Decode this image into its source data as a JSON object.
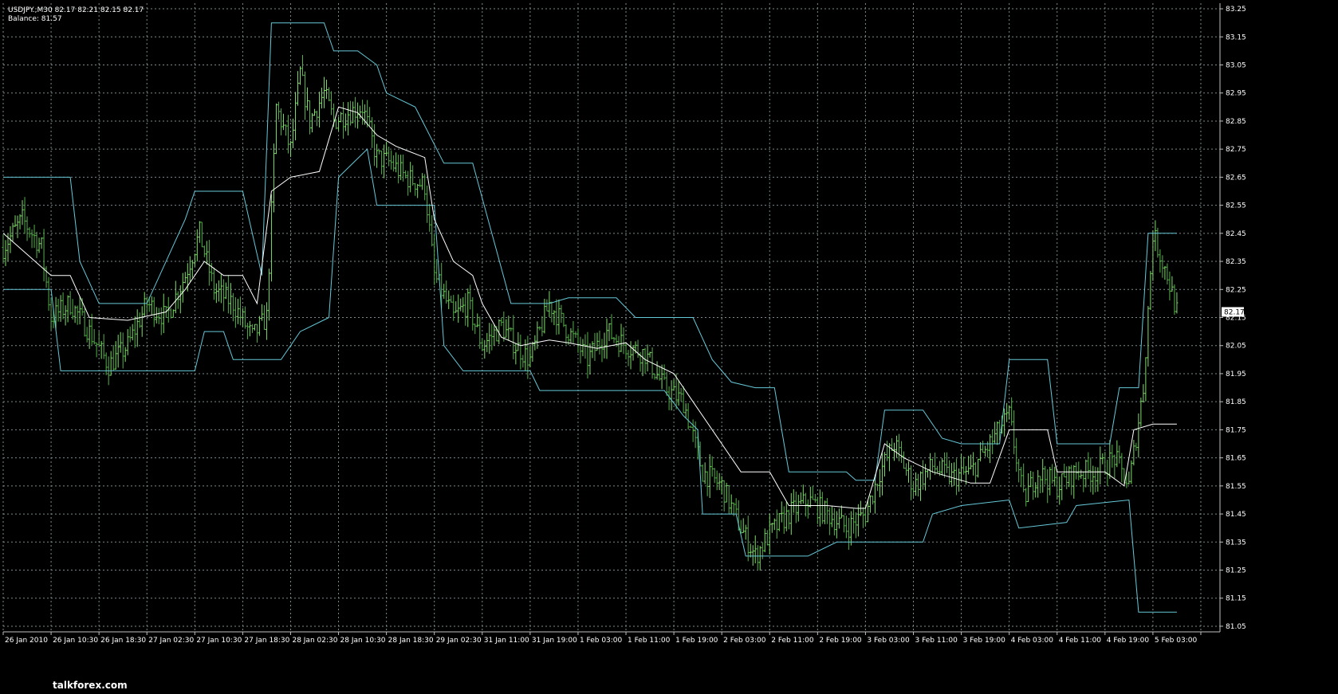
{
  "header": {
    "symbol_line": "USDJPY.,M30  82.17 82.21 82.15 82.17",
    "balance_line": "Balance: 81.57"
  },
  "watermark": {
    "text": "talkforex.com"
  },
  "colors": {
    "background": "#000000",
    "grid": "#7a8a8a",
    "bars": "#55b04a",
    "bars_bright": "#7fdc6a",
    "channel": "#66c8d8",
    "midline": "#ffffff",
    "axis": "#bfbfbf",
    "price_box": "#ffffff"
  },
  "chart_data": {
    "type": "line",
    "title": "",
    "symbol": "USDJPY.",
    "timeframe": "M30",
    "ylim": [
      81.03,
      83.27
    ],
    "yticks": [
      81.05,
      81.15,
      81.25,
      81.35,
      81.45,
      81.55,
      81.65,
      81.75,
      81.85,
      81.95,
      82.05,
      82.15,
      82.25,
      82.35,
      82.45,
      82.55,
      82.65,
      82.75,
      82.85,
      82.95,
      83.05,
      83.15,
      83.25
    ],
    "ytick_labels": [
      "81.05",
      "81.15",
      "81.25",
      "81.35",
      "81.45",
      "81.55",
      "81.65",
      "81.75",
      "81.85",
      "81.95",
      "82.05",
      "82.15",
      "82.25",
      "82.35",
      "82.45",
      "82.55",
      "82.65",
      "82.75",
      "82.85",
      "82.95",
      "83.05",
      "83.15",
      "83.25"
    ],
    "current_price": "82.17",
    "xlim": [
      0,
      254
    ],
    "xticks": [
      0,
      10,
      20,
      30,
      40,
      50,
      60,
      70,
      80,
      90,
      100,
      110,
      120,
      130,
      140,
      150,
      160,
      170,
      180,
      190,
      200,
      210,
      220,
      230,
      240,
      250
    ],
    "xtick_labels": [
      "26 Jan 2010",
      "26 Jan 10:30",
      "26 Jan 18:30",
      "27 Jan 02:30",
      "27 Jan 10:30",
      "27 Jan 18:30",
      "28 Jan 02:30",
      "28 Jan 10:30",
      "28 Jan 18:30",
      "29 Jan 02:30",
      "31 Jan 11:00",
      "31 Jan 19:00",
      "1 Feb 03:00",
      "1 Feb 11:00",
      "1 Feb 19:00",
      "2 Feb 03:00",
      "2 Feb 11:00",
      "2 Feb 19:00",
      "3 Feb 03:00",
      "3 Feb 11:00",
      "3 Feb 19:00",
      "4 Feb 03:00",
      "4 Feb 11:00",
      "4 Feb 19:00",
      "5 Feb 03:00",
      ""
    ],
    "close_anchors": [
      [
        0,
        82.4
      ],
      [
        4,
        82.5
      ],
      [
        8,
        82.4
      ],
      [
        10,
        82.15
      ],
      [
        14,
        82.2
      ],
      [
        18,
        82.1
      ],
      [
        22,
        81.98
      ],
      [
        26,
        82.05
      ],
      [
        30,
        82.2
      ],
      [
        34,
        82.15
      ],
      [
        38,
        82.3
      ],
      [
        41,
        82.45
      ],
      [
        44,
        82.25
      ],
      [
        48,
        82.2
      ],
      [
        52,
        82.08
      ],
      [
        55,
        82.15
      ],
      [
        57,
        82.9
      ],
      [
        60,
        82.75
      ],
      [
        62,
        83.02
      ],
      [
        64,
        82.85
      ],
      [
        67,
        82.95
      ],
      [
        69,
        82.85
      ],
      [
        72,
        82.88
      ],
      [
        75,
        82.9
      ],
      [
        78,
        82.72
      ],
      [
        81,
        82.7
      ],
      [
        84,
        82.65
      ],
      [
        88,
        82.62
      ],
      [
        90,
        82.3
      ],
      [
        94,
        82.15
      ],
      [
        97,
        82.2
      ],
      [
        100,
        82.05
      ],
      [
        104,
        82.12
      ],
      [
        107,
        82.05
      ],
      [
        110,
        82.0
      ],
      [
        114,
        82.2
      ],
      [
        118,
        82.1
      ],
      [
        122,
        82.0
      ],
      [
        126,
        82.1
      ],
      [
        130,
        82.05
      ],
      [
        134,
        82.02
      ],
      [
        138,
        81.9
      ],
      [
        142,
        81.85
      ],
      [
        146,
        81.6
      ],
      [
        150,
        81.55
      ],
      [
        154,
        81.4
      ],
      [
        157,
        81.3
      ],
      [
        160,
        81.38
      ],
      [
        164,
        81.45
      ],
      [
        168,
        81.5
      ],
      [
        172,
        81.45
      ],
      [
        176,
        81.4
      ],
      [
        180,
        81.45
      ],
      [
        183,
        81.6
      ],
      [
        186,
        81.7
      ],
      [
        190,
        81.55
      ],
      [
        194,
        81.62
      ],
      [
        198,
        81.58
      ],
      [
        202,
        81.6
      ],
      [
        206,
        81.7
      ],
      [
        210,
        81.8
      ],
      [
        213,
        81.5
      ],
      [
        216,
        81.6
      ],
      [
        220,
        81.55
      ],
      [
        224,
        81.6
      ],
      [
        228,
        81.6
      ],
      [
        232,
        81.65
      ],
      [
        235,
        81.55
      ],
      [
        238,
        81.9
      ],
      [
        240,
        82.45
      ],
      [
        243,
        82.3
      ],
      [
        245,
        82.17
      ]
    ],
    "series": [
      {
        "role": "upper channel",
        "points": [
          [
            0,
            82.65
          ],
          [
            8,
            82.65
          ],
          [
            14,
            82.65
          ],
          [
            16,
            82.35
          ],
          [
            20,
            82.2
          ],
          [
            30,
            82.2
          ],
          [
            38,
            82.5
          ],
          [
            40,
            82.6
          ],
          [
            50,
            82.6
          ],
          [
            54,
            82.3
          ],
          [
            56,
            83.2
          ],
          [
            67,
            83.2
          ],
          [
            69,
            83.1
          ],
          [
            74,
            83.1
          ],
          [
            78,
            83.05
          ],
          [
            80,
            82.95
          ],
          [
            86,
            82.9
          ],
          [
            92,
            82.7
          ],
          [
            98,
            82.7
          ],
          [
            102,
            82.45
          ],
          [
            106,
            82.2
          ],
          [
            114,
            82.2
          ],
          [
            118,
            82.22
          ],
          [
            128,
            82.22
          ],
          [
            132,
            82.15
          ],
          [
            144,
            82.15
          ],
          [
            148,
            82.0
          ],
          [
            152,
            81.92
          ],
          [
            157,
            81.9
          ],
          [
            161,
            81.9
          ],
          [
            164,
            81.6
          ],
          [
            176,
            81.6
          ],
          [
            178,
            81.57
          ],
          [
            182,
            81.57
          ],
          [
            184,
            81.82
          ],
          [
            192,
            81.82
          ],
          [
            196,
            81.72
          ],
          [
            200,
            81.7
          ],
          [
            208,
            81.7
          ],
          [
            210,
            82.0
          ],
          [
            218,
            82.0
          ],
          [
            220,
            81.7
          ],
          [
            231,
            81.7
          ],
          [
            233,
            81.9
          ],
          [
            237,
            81.9
          ],
          [
            239,
            82.45
          ],
          [
            245,
            82.45
          ]
        ]
      },
      {
        "role": "lower channel",
        "points": [
          [
            0,
            82.25
          ],
          [
            10,
            82.25
          ],
          [
            12,
            81.96
          ],
          [
            30,
            81.96
          ],
          [
            40,
            81.96
          ],
          [
            42,
            82.1
          ],
          [
            46,
            82.1
          ],
          [
            48,
            82.0
          ],
          [
            58,
            82.0
          ],
          [
            62,
            82.1
          ],
          [
            68,
            82.15
          ],
          [
            70,
            82.65
          ],
          [
            76,
            82.75
          ],
          [
            78,
            82.55
          ],
          [
            90,
            82.55
          ],
          [
            92,
            82.05
          ],
          [
            96,
            81.96
          ],
          [
            110,
            81.96
          ],
          [
            112,
            81.89
          ],
          [
            122,
            81.89
          ],
          [
            124,
            81.89
          ],
          [
            138,
            81.89
          ],
          [
            142,
            81.8
          ],
          [
            145,
            81.75
          ],
          [
            146,
            81.45
          ],
          [
            153,
            81.45
          ],
          [
            155,
            81.3
          ],
          [
            168,
            81.3
          ],
          [
            174,
            81.35
          ],
          [
            192,
            81.35
          ],
          [
            194,
            81.45
          ],
          [
            200,
            81.48
          ],
          [
            210,
            81.5
          ],
          [
            212,
            81.4
          ],
          [
            222,
            81.42
          ],
          [
            224,
            81.48
          ],
          [
            235,
            81.5
          ],
          [
            237,
            81.1
          ],
          [
            245,
            81.1
          ]
        ]
      },
      {
        "role": "middle line",
        "points": [
          [
            0,
            82.45
          ],
          [
            10,
            82.3
          ],
          [
            14,
            82.3
          ],
          [
            18,
            82.15
          ],
          [
            26,
            82.14
          ],
          [
            34,
            82.17
          ],
          [
            38,
            82.25
          ],
          [
            42,
            82.35
          ],
          [
            46,
            82.3
          ],
          [
            50,
            82.3
          ],
          [
            53,
            82.2
          ],
          [
            56,
            82.6
          ],
          [
            60,
            82.65
          ],
          [
            66,
            82.67
          ],
          [
            70,
            82.9
          ],
          [
            74,
            82.88
          ],
          [
            78,
            82.8
          ],
          [
            82,
            82.76
          ],
          [
            88,
            82.72
          ],
          [
            90,
            82.5
          ],
          [
            94,
            82.35
          ],
          [
            98,
            82.3
          ],
          [
            100,
            82.2
          ],
          [
            104,
            82.08
          ],
          [
            108,
            82.05
          ],
          [
            114,
            82.07
          ],
          [
            118,
            82.06
          ],
          [
            124,
            82.04
          ],
          [
            130,
            82.06
          ],
          [
            134,
            82.0
          ],
          [
            140,
            81.95
          ],
          [
            144,
            81.85
          ],
          [
            150,
            81.7
          ],
          [
            154,
            81.6
          ],
          [
            160,
            81.6
          ],
          [
            164,
            81.48
          ],
          [
            172,
            81.48
          ],
          [
            178,
            81.47
          ],
          [
            180,
            81.47
          ],
          [
            184,
            81.7
          ],
          [
            188,
            81.65
          ],
          [
            194,
            81.6
          ],
          [
            198,
            81.58
          ],
          [
            202,
            81.56
          ],
          [
            206,
            81.56
          ],
          [
            210,
            81.75
          ],
          [
            214,
            81.75
          ],
          [
            218,
            81.75
          ],
          [
            220,
            81.6
          ],
          [
            226,
            81.6
          ],
          [
            230,
            81.6
          ],
          [
            234,
            81.55
          ],
          [
            236,
            81.75
          ],
          [
            240,
            81.77
          ],
          [
            245,
            81.77
          ]
        ]
      }
    ]
  }
}
